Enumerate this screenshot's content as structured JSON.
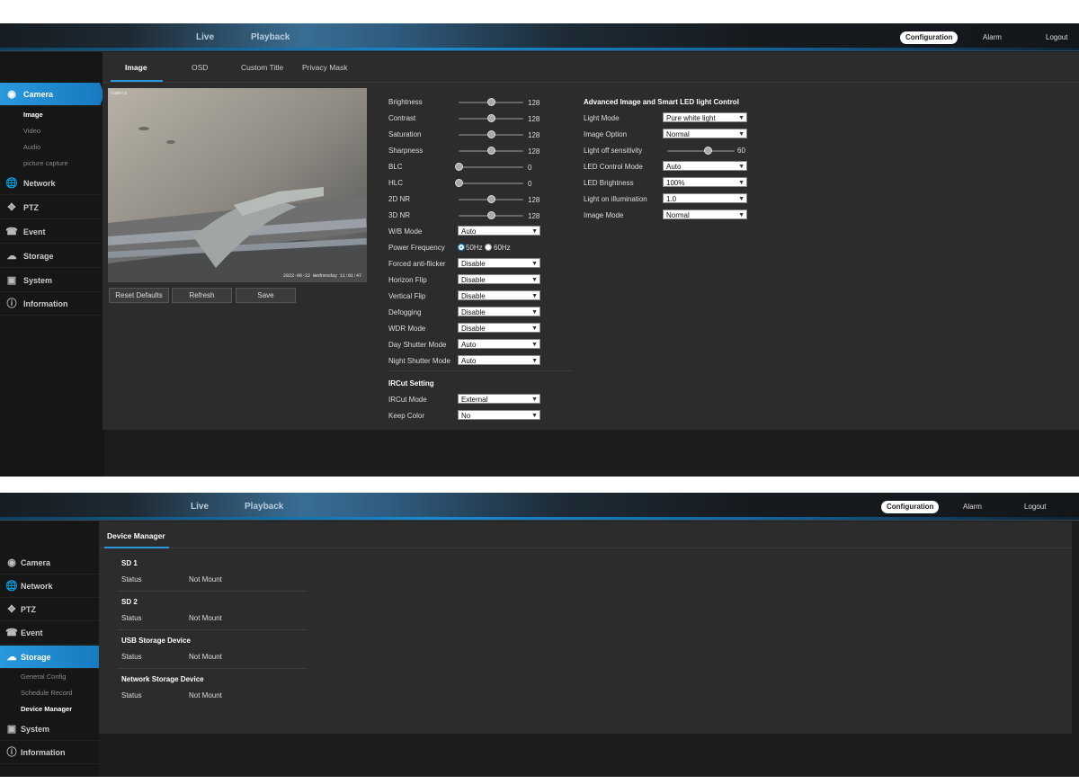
{
  "top": {
    "live": "Live",
    "playback": "Playback",
    "configuration": "Configuration",
    "alarm": "Alarm",
    "logout": "Logout"
  },
  "sidebar": {
    "camera": "Camera",
    "network": "Network",
    "ptz": "PTZ",
    "event": "Event",
    "storage": "Storage",
    "system": "System",
    "information": "Information",
    "camera_sub": [
      "Image",
      "Video",
      "Audio",
      "picture capture"
    ],
    "storage_sub": [
      "General Config",
      "Schedule Record",
      "Device Manager"
    ]
  },
  "image_page": {
    "tabs": [
      "Image",
      "OSD",
      "Custom Title",
      "Privacy Mask"
    ],
    "video": {
      "corner_label": "Camera",
      "timestamp": "2022-06-22 Wednesday 11:01:47"
    },
    "buttons": {
      "reset": "Reset Defaults",
      "refresh": "Refresh",
      "save": "Save"
    },
    "sliders": [
      {
        "label": "Brightness",
        "value": 128,
        "fraction": 0.5
      },
      {
        "label": "Contrast",
        "value": 128,
        "fraction": 0.5
      },
      {
        "label": "Saturation",
        "value": 128,
        "fraction": 0.5
      },
      {
        "label": "Sharpness",
        "value": 128,
        "fraction": 0.5
      },
      {
        "label": "BLC",
        "value": 0,
        "fraction": 0
      },
      {
        "label": "HLC",
        "value": 0,
        "fraction": 0
      },
      {
        "label": "2D NR",
        "value": 128,
        "fraction": 0.5
      },
      {
        "label": "3D NR",
        "value": 128,
        "fraction": 0.5
      }
    ],
    "wb_mode": {
      "label": "W/B Mode",
      "value": "Auto"
    },
    "power_frequency": {
      "label": "Power Frequency",
      "opt1": "50Hz",
      "opt2": "60Hz",
      "selected": "50Hz"
    },
    "selects": [
      {
        "label": "Forced anti-flicker",
        "value": "Disable"
      },
      {
        "label": "Horizon Flip",
        "value": "Disable"
      },
      {
        "label": "Vertical Flip",
        "value": "Disable"
      },
      {
        "label": "Defogging",
        "value": "Disable"
      },
      {
        "label": "WDR Mode",
        "value": "Disable"
      },
      {
        "label": "Day Shutter Mode",
        "value": "Auto"
      },
      {
        "label": "Night Shutter Mode",
        "value": "Auto"
      }
    ],
    "ircut": {
      "title": "IRCut Setting",
      "mode_label": "IRCut Mode",
      "mode_value": "External",
      "color_label": "Keep Color",
      "color_value": "No"
    },
    "advanced": {
      "title": "Advanced Image and Smart LED light Control",
      "light_mode": {
        "label": "Light Mode",
        "value": "Pure white light"
      },
      "image_option": {
        "label": "Image Option",
        "value": "Normal"
      },
      "light_off": {
        "label": "Light off sensitivity",
        "value": 60,
        "fraction": 0.6
      },
      "led_control": {
        "label": "LED Control Mode",
        "value": "Auto"
      },
      "led_brightness": {
        "label": "LED Brightness",
        "value": "100%"
      },
      "light_on": {
        "label": "Light on illumination",
        "value": "1.0"
      },
      "image_mode": {
        "label": "Image Mode",
        "value": "Normal"
      }
    }
  },
  "device_page": {
    "title": "Device Manager",
    "sections": [
      {
        "name": "SD 1",
        "status_label": "Status",
        "status_value": "Not Mount"
      },
      {
        "name": "SD 2",
        "status_label": "Status",
        "status_value": "Not Mount"
      },
      {
        "name": "USB Storage Device",
        "status_label": "Status",
        "status_value": "Not Mount"
      },
      {
        "name": "Network Storage Device",
        "status_label": "Status",
        "status_value": "Not Mount"
      }
    ]
  }
}
